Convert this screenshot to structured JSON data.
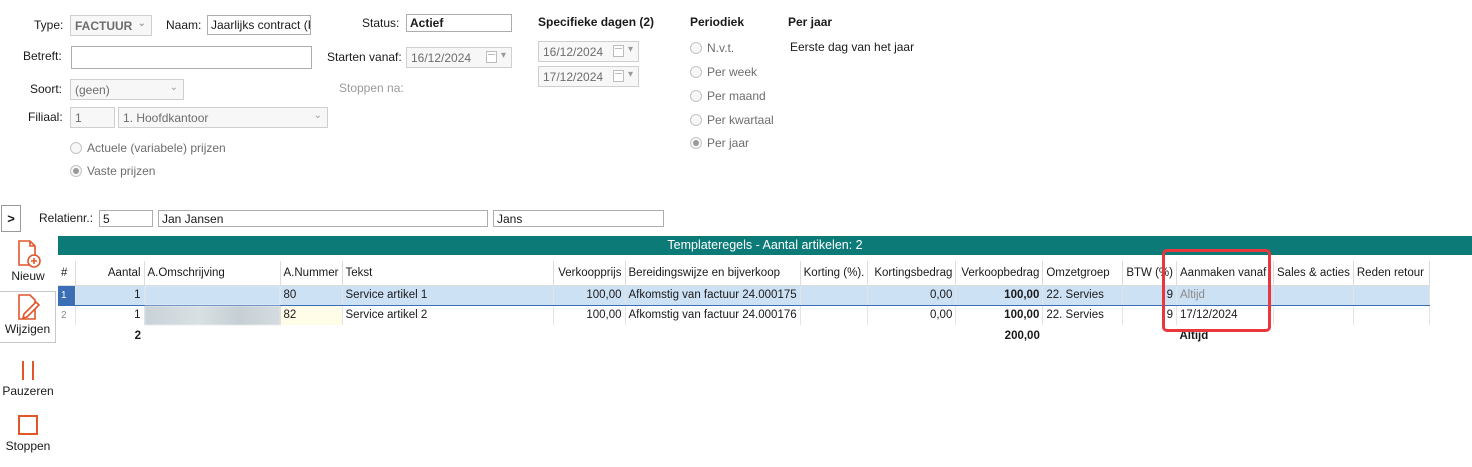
{
  "header": {
    "type_label": "Type:",
    "type_value": "FACTUUR",
    "naam_label": "Naam:",
    "naam_value": "Jaarlijks contract (F",
    "status_label": "Status:",
    "status_value": "Actief",
    "betreft_label": "Betreft:",
    "betreft_value": "",
    "starten_label": "Starten vanaf:",
    "starten_value": "16/12/2024",
    "stoppen_label": "Stoppen na:",
    "soort_label": "Soort:",
    "soort_value": "(geen)",
    "filiaal_label": "Filiaal:",
    "filiaal_nr": "1",
    "filiaal_value": "1. Hoofdkantoor",
    "prijzen_options": [
      "Actuele (variabele) prijzen",
      "Vaste prijzen"
    ],
    "prijzen_selected": "Vaste prijzen"
  },
  "specifieke": {
    "title": "Specifieke dagen (2)",
    "dates": [
      "16/12/2024",
      "17/12/2024"
    ]
  },
  "periodiek": {
    "title": "Periodiek",
    "options": [
      "N.v.t.",
      "Per week",
      "Per maand",
      "Per kwartaal",
      "Per jaar"
    ],
    "selected": "Per jaar"
  },
  "per_jaar": {
    "title": "Per jaar",
    "value": "Eerste dag van het jaar"
  },
  "relatie": {
    "toggle": ">",
    "label": "Relatienr.:",
    "nr": "5",
    "name": "Jan Jansen",
    "short": "Jans"
  },
  "toolbar": {
    "nieuw": "Nieuw",
    "wijzigen": "Wijzigen",
    "pauzeren": "Pauzeren",
    "stoppen": "Stoppen"
  },
  "grid": {
    "title": "Templateregels - Aantal artikelen: 2",
    "columns": [
      "#",
      "Aantal",
      "A.Omschrijving",
      "A.Nummer",
      "Tekst",
      "Verkoopprijs",
      "Bereidingswijze en bijverkoop",
      "Korting (%).",
      "Kortingsbedrag",
      "Verkoopbedrag",
      "Omzetgroep",
      "BTW (%)",
      "Aanmaken vanaf",
      "Sales & acties",
      "Reden retour"
    ],
    "rows": [
      {
        "num": "1",
        "aantal": "1",
        "omschrijving": "",
        "nummer": "80",
        "tekst": "Service artikel 1",
        "verkoopprijs": "100,00",
        "bereiding": "Afkomstig van factuur 24.000175",
        "korting": "",
        "kortingsbedrag": "0,00",
        "verkoopbedrag": "100,00",
        "omzetgroep": "22. Servies",
        "btw": "9",
        "aanmaken": "Altijd",
        "sales": "",
        "reden": ""
      },
      {
        "num": "2",
        "aantal": "1",
        "omschrijving": "",
        "nummer": "82",
        "tekst": "Service artikel 2",
        "verkoopprijs": "100,00",
        "bereiding": "Afkomstig van factuur 24.000176",
        "korting": "",
        "kortingsbedrag": "0,00",
        "verkoopbedrag": "100,00",
        "omzetgroep": "22. Servies",
        "btw": "9",
        "aanmaken": "17/12/2024",
        "sales": "",
        "reden": ""
      }
    ],
    "footer": {
      "aantal": "2",
      "verkoopbedrag": "200,00",
      "aanmaken": "Altijd"
    }
  },
  "colors": {
    "grid_header": "#0c7a77",
    "accent_icon": "#e2562b",
    "highlight_box": "#e8383d",
    "selected_row": "#cde1f5"
  }
}
